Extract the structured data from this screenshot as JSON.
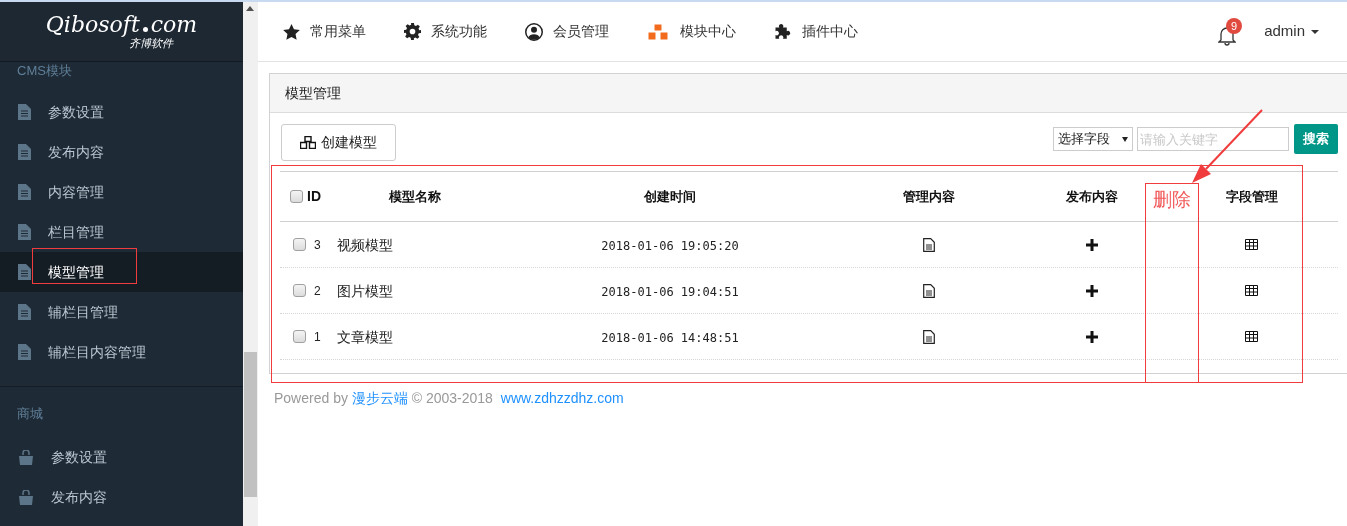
{
  "logo": {
    "name": "Qibosoft",
    "domain": "com",
    "subtitle": "齐博软件"
  },
  "sidebar": {
    "groups": [
      {
        "title": "CMS模块",
        "items": [
          {
            "label": "参数设置",
            "kind": "document",
            "selected": false
          },
          {
            "label": "发布内容",
            "kind": "document",
            "selected": false
          },
          {
            "label": "内容管理",
            "kind": "document",
            "selected": false
          },
          {
            "label": "栏目管理",
            "kind": "document",
            "selected": false
          },
          {
            "label": "模型管理",
            "kind": "document",
            "selected": true
          },
          {
            "label": "辅栏目管理",
            "kind": "document",
            "selected": false
          },
          {
            "label": "辅栏目内容管理",
            "kind": "document",
            "selected": false
          }
        ]
      },
      {
        "title": "商城",
        "items": [
          {
            "label": "参数设置",
            "kind": "bag",
            "selected": false
          },
          {
            "label": "发布内容",
            "kind": "bag",
            "selected": false
          }
        ]
      }
    ]
  },
  "top_nav": [
    {
      "label": "常用菜单",
      "kind": "star"
    },
    {
      "label": "系统功能",
      "kind": "gear"
    },
    {
      "label": "会员管理",
      "kind": "user"
    },
    {
      "label": "模块中心",
      "kind": "cubes"
    },
    {
      "label": "插件中心",
      "kind": "puzzle"
    }
  ],
  "notifications": {
    "count": "9"
  },
  "user": {
    "name": "admin"
  },
  "panel": {
    "title": "模型管理",
    "create_button": "创建模型",
    "search": {
      "field_select": "选择字段",
      "placeholder": "请输入关键字",
      "button": "搜索"
    },
    "table": {
      "columns": [
        "ID",
        "模型名称",
        "创建时间",
        "管理内容",
        "发布内容",
        "字段管理"
      ],
      "select_all_checked": false,
      "rows": [
        {
          "checked": false,
          "id": "3",
          "name": "视频模型",
          "created": "2018-01-06 19:05:20"
        },
        {
          "checked": false,
          "id": "2",
          "name": "图片模型",
          "created": "2018-01-06 19:04:51"
        },
        {
          "checked": false,
          "id": "1",
          "name": "文章模型",
          "created": "2018-01-06 14:48:51"
        }
      ]
    }
  },
  "footer": {
    "prefix": "Powered by",
    "company": "漫步云端",
    "copyright": "© 2003-2018",
    "website": "www.zdhzzdhz.com"
  },
  "annotations": {
    "delete_label": "删除"
  }
}
